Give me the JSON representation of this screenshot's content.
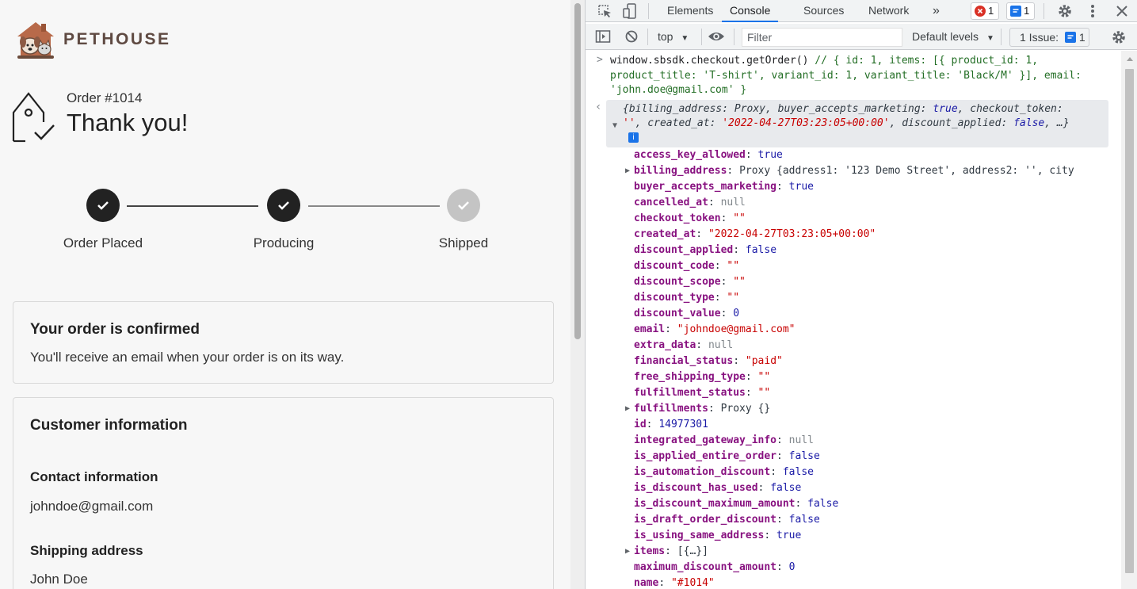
{
  "page": {
    "brand": "PETHOUSE",
    "order_number": "Order #1014",
    "thank_you": "Thank you!",
    "steps": [
      {
        "label": "Order Placed",
        "done": true
      },
      {
        "label": "Producing",
        "done": true
      },
      {
        "label": "Shipped",
        "done": false
      }
    ],
    "confirm_title": "Your order is confirmed",
    "confirm_text": "You'll receive an email when your order is on its way.",
    "customer_title": "Customer information",
    "contact_title": "Contact information",
    "contact_email": "johndoe@gmail.com",
    "shipping_title": "Shipping address",
    "shipping_name": "John Doe"
  },
  "devtools": {
    "tabs": [
      "Elements",
      "Console",
      "Sources",
      "Network"
    ],
    "active_tab": "Console",
    "more": "»",
    "error_count": "1",
    "message_count": "1",
    "context": "top",
    "filter_placeholder": "Filter",
    "levels": "Default levels",
    "issues_label": "1 Issue:",
    "issues_count": "1",
    "command_code": "window.sbsdk.checkout.getOrder()",
    "command_comment": " // { id: 1, items: [{ product_id: 1, product_title: 'T-shirt', variant_id: 1, variant_title: 'Black/M' }], email: 'john.doe@gmail.com' }",
    "summary": {
      "line1_a": "{billing_address: Proxy, buyer_accepts_marketing: ",
      "line1_b": "true",
      "line1_c": ", checkout_token:",
      "line2_a": "''",
      "line2_b": ", created_at: ",
      "line2_c": "'2022-04-27T03:23:05+00:00'",
      "line2_d": ", discount_applied: ",
      "line2_e": "false",
      "line2_f": ", …}",
      "info": "i"
    },
    "properties": [
      {
        "key": "access_key_allowed",
        "value": "true",
        "type": "bool"
      },
      {
        "key": "billing_address",
        "value": "Proxy {address1: '123 Demo Street', address2: '', city",
        "type": "obj",
        "expandable": true
      },
      {
        "key": "buyer_accepts_marketing",
        "value": "true",
        "type": "bool"
      },
      {
        "key": "cancelled_at",
        "value": "null",
        "type": "null"
      },
      {
        "key": "checkout_token",
        "value": "\"\"",
        "type": "str"
      },
      {
        "key": "created_at",
        "value": "\"2022-04-27T03:23:05+00:00\"",
        "type": "str"
      },
      {
        "key": "discount_applied",
        "value": "false",
        "type": "bool"
      },
      {
        "key": "discount_code",
        "value": "\"\"",
        "type": "str"
      },
      {
        "key": "discount_scope",
        "value": "\"\"",
        "type": "str"
      },
      {
        "key": "discount_type",
        "value": "\"\"",
        "type": "str"
      },
      {
        "key": "discount_value",
        "value": "0",
        "type": "num"
      },
      {
        "key": "email",
        "value": "\"johndoe@gmail.com\"",
        "type": "str"
      },
      {
        "key": "extra_data",
        "value": "null",
        "type": "null"
      },
      {
        "key": "financial_status",
        "value": "\"paid\"",
        "type": "str"
      },
      {
        "key": "free_shipping_type",
        "value": "\"\"",
        "type": "str"
      },
      {
        "key": "fulfillment_status",
        "value": "\"\"",
        "type": "str"
      },
      {
        "key": "fulfillments",
        "value": "Proxy {}",
        "type": "obj",
        "expandable": true
      },
      {
        "key": "id",
        "value": "14977301",
        "type": "num"
      },
      {
        "key": "integrated_gateway_info",
        "value": "null",
        "type": "null"
      },
      {
        "key": "is_applied_entire_order",
        "value": "false",
        "type": "bool"
      },
      {
        "key": "is_automation_discount",
        "value": "false",
        "type": "bool"
      },
      {
        "key": "is_discount_has_used",
        "value": "false",
        "type": "bool"
      },
      {
        "key": "is_discount_maximum_amount",
        "value": "false",
        "type": "bool"
      },
      {
        "key": "is_draft_order_discount",
        "value": "false",
        "type": "bool"
      },
      {
        "key": "is_using_same_address",
        "value": "true",
        "type": "bool"
      },
      {
        "key": "items",
        "value": "[{…}]",
        "type": "obj",
        "expandable": true
      },
      {
        "key": "maximum_discount_amount",
        "value": "0",
        "type": "num"
      },
      {
        "key": "name",
        "value": "\"#1014\"",
        "type": "str"
      }
    ],
    "colors": {
      "key": "#881280",
      "string": "#c80000",
      "keyword": "#1a1aa6",
      "null": "#80868b",
      "accent": "#1a73e8",
      "error": "#d93025"
    }
  }
}
